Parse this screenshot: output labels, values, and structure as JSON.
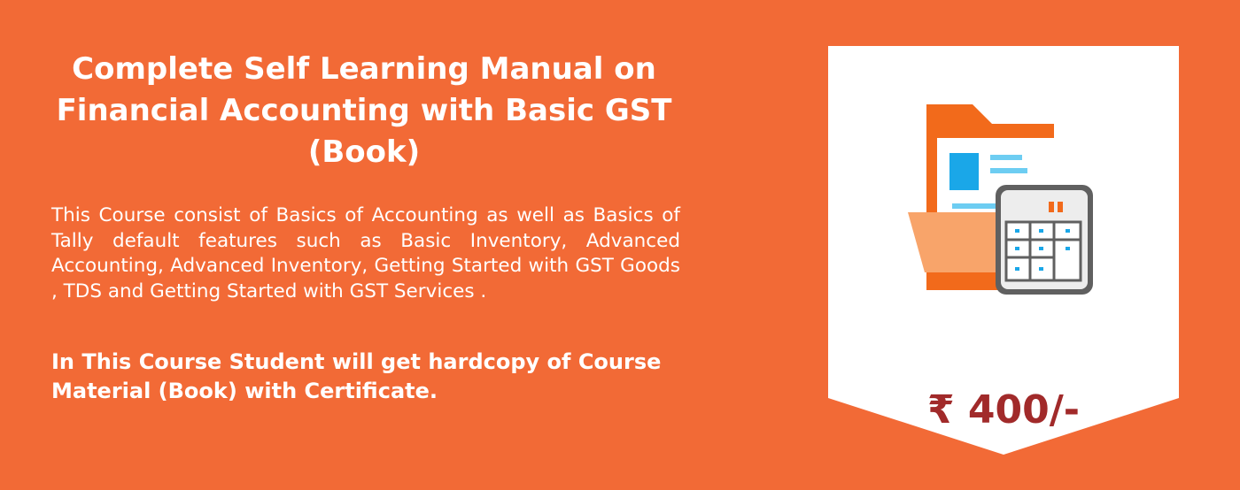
{
  "course": {
    "title_lines": [
      "Complete Self Learning Manual on",
      "Financial Accounting with Basic GST",
      "(Book)"
    ],
    "description": "This Course consist of  Basics of Accounting as well as Basics of Tally default features such as  Basic Inventory, Advanced Accounting, Advanced Inventory, Getting Started with GST Goods , TDS and Getting Started with GST Services .",
    "highlight_lines": [
      "In This Course Student will get hardcopy of Course",
      "Material (Book) with Certificate."
    ]
  },
  "price": {
    "label": "₹ 400/-",
    "color": "#a12a2a"
  },
  "icon": "folder-calculator-icon",
  "colors": {
    "background": "#f26a36",
    "card": "#ffffff",
    "text": "#ffffff"
  }
}
